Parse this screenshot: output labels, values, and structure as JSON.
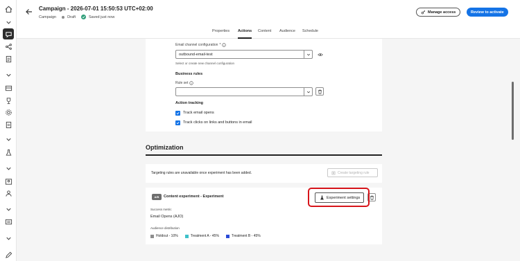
{
  "header": {
    "title": "Campaign - 2026-07-01 15:50:53 UTC+02:00",
    "type_label": "Campaign",
    "status": "Draft",
    "saved": "Saved just now",
    "manage_access": "Manage access",
    "review": "Review to activate"
  },
  "tabs": [
    "Properties",
    "Actions",
    "Content",
    "Audience",
    "Schedule"
  ],
  "active_tab": "Actions",
  "email": {
    "config_label": "Email channel configuration",
    "config_value": "outbound-email-test",
    "config_helper": "Select or create new channel configuration"
  },
  "business_rules": {
    "title": "Business rules",
    "rule_set_label": "Rule set",
    "rule_set_value": ""
  },
  "tracking": {
    "title": "Action tracking",
    "opens": "Track email opens",
    "clicks": "Track clicks on links and buttons in email"
  },
  "optimization": {
    "title": "Optimization",
    "targeting_note": "Targeting rules are unavailable once experiment has been added.",
    "create_rule": "Create targeting rule"
  },
  "experiment": {
    "badge": "A/B",
    "title": "Content experiment - Experiment",
    "settings_button": "Experiment settings",
    "metric_label": "Success metric",
    "metric_value": "Email Opens (AJO)",
    "distribution_label": "Audience distribution",
    "distribution": [
      {
        "label": "Holdout - 10%",
        "color": "#8e8e8e"
      },
      {
        "label": "Treatment A - 45%",
        "color": "#3ec1c9"
      },
      {
        "label": "Treatment B - 45%",
        "color": "#2a4bd7"
      }
    ]
  },
  "colors": {
    "accent": "#1473e6",
    "highlight": "#d7141a"
  }
}
